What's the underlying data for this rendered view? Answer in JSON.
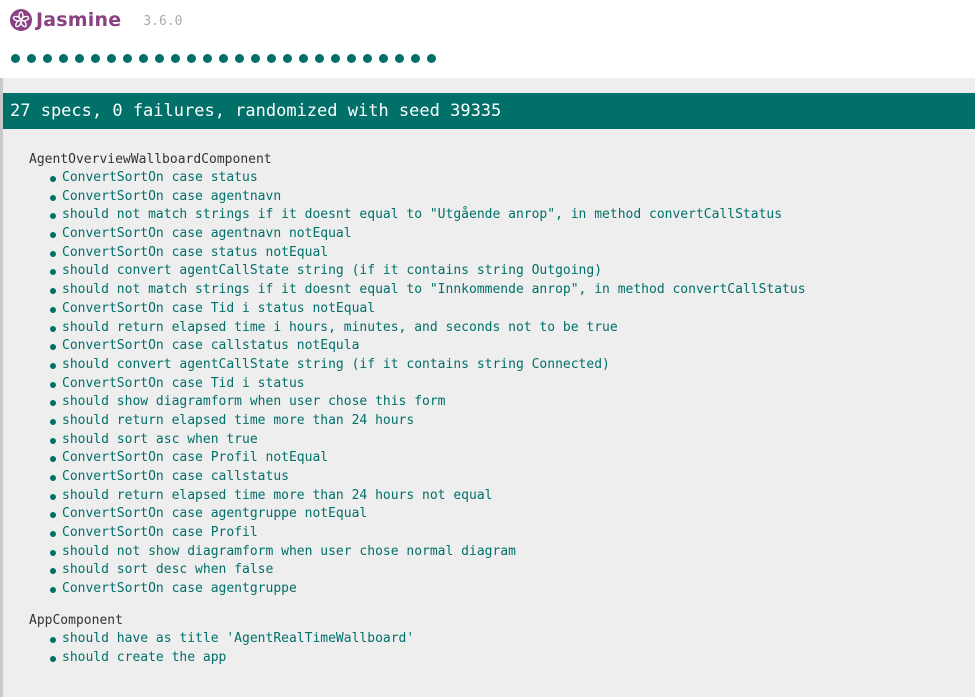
{
  "banner": {
    "title": "Jasmine",
    "version": "3.6.0",
    "logo_icon": "jasmine-flower-icon"
  },
  "symbol_summary": {
    "passed_count": 27,
    "color": "#007069"
  },
  "summary": {
    "text": "27 specs, 0 failures, randomized with seed 39335"
  },
  "colors": {
    "brand": "#8a4182",
    "passed": "#007069",
    "background": "#eeeeee"
  },
  "suites": [
    {
      "name": "AgentOverviewWallboardComponent",
      "specs": [
        "ConvertSortOn case status",
        "ConvertSortOn case agentnavn",
        "should not match strings if it doesnt equal to \"Utgående anrop\", in method convertCallStatus",
        "ConvertSortOn case agentnavn notEqual",
        "ConvertSortOn case status notEqual",
        "should convert agentCallState string (if it contains string Outgoing)",
        "should not match strings if it doesnt equal to \"Innkommende anrop\", in method convertCallStatus",
        "ConvertSortOn case Tid i status notEqual",
        "should return elapsed time i hours, minutes, and seconds not to be true",
        "ConvertSortOn case callstatus notEqula",
        "should convert agentCallState string (if it contains string Connected)",
        "ConvertSortOn case Tid i status",
        "should show diagramform when user chose this form",
        "should return elapsed time more than 24 hours",
        "should sort asc when true",
        "ConvertSortOn case Profil notEqual",
        "ConvertSortOn case callstatus",
        "should return elapsed time more than 24 hours not equal",
        "ConvertSortOn case agentgruppe notEqual",
        "ConvertSortOn case Profil",
        "should not show diagramform when user chose normal diagram",
        "should sort desc when false",
        "ConvertSortOn case agentgruppe"
      ]
    },
    {
      "name": "AppComponent",
      "specs": [
        "should have as title 'AgentRealTimeWallboard'",
        "should create the app"
      ]
    }
  ]
}
